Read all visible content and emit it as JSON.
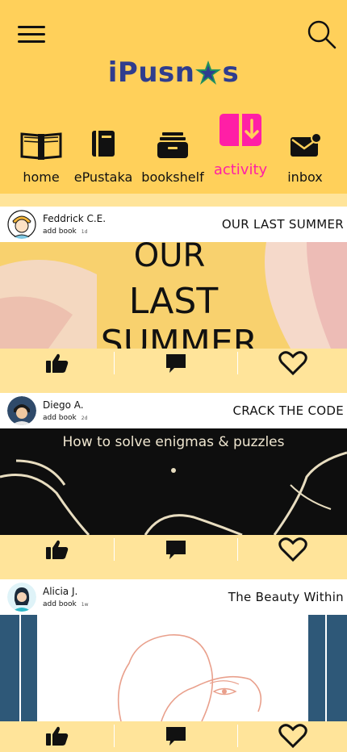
{
  "app": {
    "logo_text": "iPusn",
    "logo_tail": "s"
  },
  "header": {
    "menu_icon": "hamburger-icon",
    "search_icon": "search-icon"
  },
  "nav": {
    "items": [
      {
        "label": "home",
        "icon": "open-book-icon"
      },
      {
        "label": "ePustaka",
        "icon": "book-icon"
      },
      {
        "label": "bookshelf",
        "icon": "shelf-box-icon"
      },
      {
        "label": "activity",
        "icon": "activity-download-icon",
        "active": true
      },
      {
        "label": "inbox",
        "icon": "mail-notification-icon"
      }
    ],
    "active_color": "#FF1FA6"
  },
  "feed": [
    {
      "user": "Feddrick C.E.",
      "action": "add book",
      "time": "1d",
      "title": "OUR LAST SUMMER",
      "cover_text": [
        "OUR",
        "LAST",
        "SUMMER"
      ]
    },
    {
      "user": "Diego A.",
      "action": "add book",
      "time": "2d",
      "title": "CRACK THE CODE",
      "cover_text": "How to solve enigmas & puzzles"
    },
    {
      "user": "Alicia J.",
      "action": "add book",
      "time": "1w",
      "title": "The Beauty Within"
    }
  ],
  "colors": {
    "header": "#FFD05A",
    "background": "#FFE49A"
  }
}
